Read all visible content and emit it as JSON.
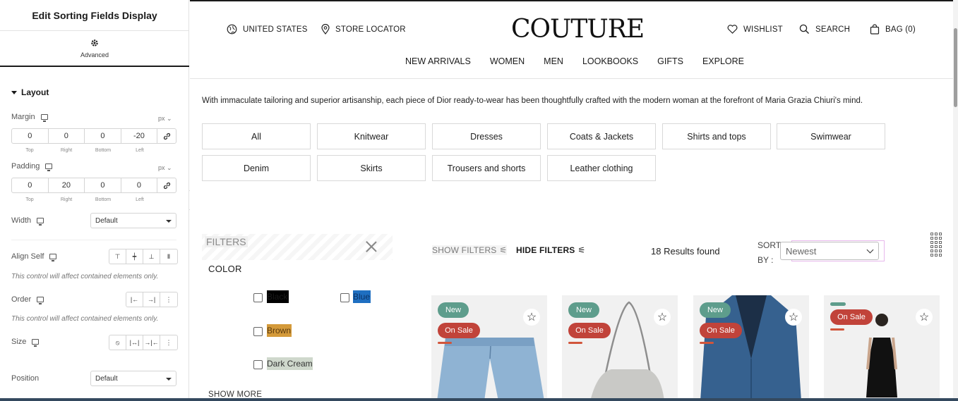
{
  "editor": {
    "title": "Edit Sorting Fields Display",
    "tab_label": "Advanced",
    "section": "Layout",
    "margin": {
      "label": "Margin",
      "unit": "px",
      "values": [
        "0",
        "0",
        "0",
        "-20"
      ],
      "sides": [
        "Top",
        "Right",
        "Bottom",
        "Left"
      ]
    },
    "padding": {
      "label": "Padding",
      "unit": "px",
      "values": [
        "0",
        "20",
        "0",
        "0"
      ],
      "sides": [
        "Top",
        "Right",
        "Bottom",
        "Left"
      ]
    },
    "width": {
      "label": "Width",
      "value": "Default"
    },
    "align_self": {
      "label": "Align Self",
      "hint": "This control will affect contained elements only."
    },
    "order": {
      "label": "Order",
      "hint": "This control will affect contained elements only."
    },
    "size": {
      "label": "Size"
    },
    "position": {
      "label": "Position",
      "value": "Default"
    }
  },
  "site": {
    "header": {
      "country": "UNITED STATES",
      "store_locator": "STORE LOCATOR",
      "logo": "COUTURE",
      "wishlist": "WISHLIST",
      "search": "SEARCH",
      "bag": "BAG (0)"
    },
    "nav": [
      "NEW ARRIVALS",
      "WOMEN",
      "MEN",
      "LOOKBOOKS",
      "GIFTS",
      "EXPLORE"
    ],
    "description": "With immaculate tailoring and superior artisanship, each piece of Dior ready-to-wear has been thoughtfully crafted with the modern woman at the forefront of Maria Grazia Chiuri's mind.",
    "categories": [
      "All",
      "Knitwear",
      "Dresses",
      "Coats & Jackets",
      "Shirts and tops",
      "Swimwear",
      "Denim",
      "Skirts",
      "Trousers and shorts",
      "Leather clothing"
    ],
    "filters": {
      "title": "FILTERS",
      "color_title": "COLOR",
      "colors": [
        {
          "name": "Black",
          "bg": "#000000",
          "fg": "#1a1a1a"
        },
        {
          "name": "Blue",
          "bg": "#1f6fc1",
          "fg": "#0b3366"
        },
        {
          "name": "Brown",
          "bg": "#d49a3a",
          "fg": "#5a3a0e"
        },
        {
          "name": "Dark Cream",
          "bg": "#cfd8cc",
          "fg": "#333333"
        }
      ],
      "show_more": "SHOW MORE"
    },
    "toolbar": {
      "show_filters": "SHOW FILTERS",
      "hide_filters": "HIDE FILTERS",
      "results": "18 Results found",
      "sort_by": "SORT BY :",
      "sort_value": "Newest"
    },
    "products": [
      {
        "badges": [
          "New",
          "On Sale"
        ],
        "item": "jeans"
      },
      {
        "badges": [
          "New",
          "On Sale"
        ],
        "item": "bag"
      },
      {
        "badges": [
          "New",
          "On Sale"
        ],
        "item": "denim-jacket"
      },
      {
        "badges": [
          "On Sale"
        ],
        "item": "dress"
      }
    ]
  },
  "colors": {
    "accent_green": "#5e9d8c",
    "accent_red": "#c1433a"
  }
}
